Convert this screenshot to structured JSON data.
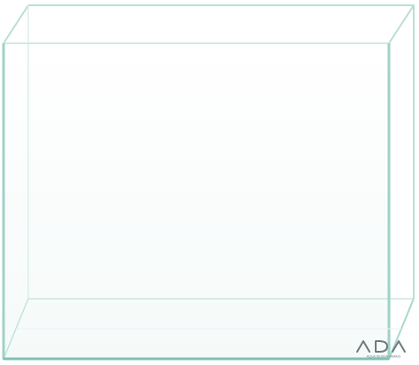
{
  "logo": {
    "brand": "ADA",
    "tagline": "AQUA DESIGN AMANO"
  },
  "colors": {
    "background": "#ffffff",
    "glass_edge": "#a9d7cf",
    "glass_edge_dark": "#7fc1b5",
    "glass_face": "#f7fbfa",
    "logo": "#6c7a7c"
  },
  "icons": {
    "object": "glass-aquarium-icon",
    "brand_mark": "ada-logo-icon"
  }
}
